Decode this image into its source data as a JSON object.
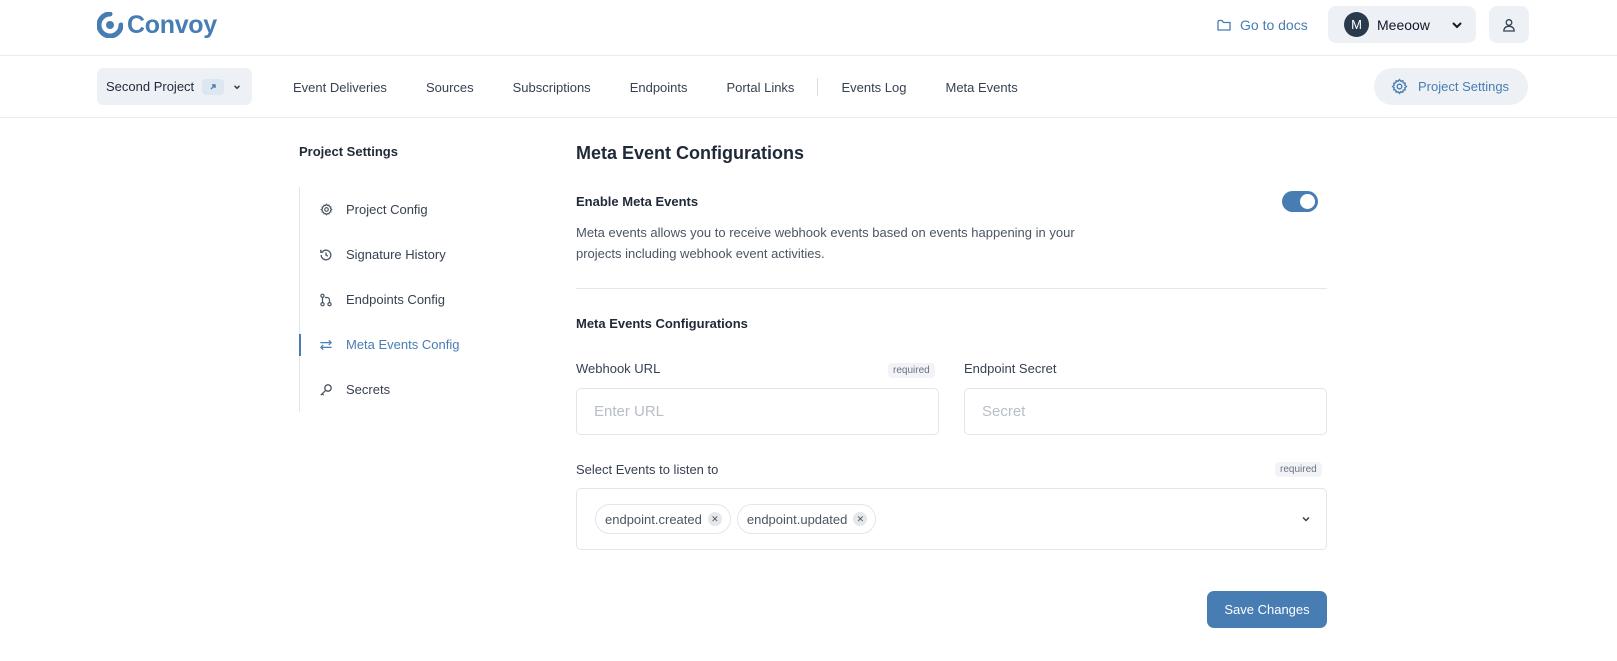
{
  "header": {
    "logo_text": "Convoy",
    "docs_link": "Go to docs",
    "user": {
      "initial": "M",
      "name": "Meeoow"
    }
  },
  "nav": {
    "project": "Second Project",
    "items": [
      "Event Deliveries",
      "Sources",
      "Subscriptions",
      "Endpoints",
      "Portal Links",
      "Events Log",
      "Meta Events"
    ],
    "settings_button": "Project Settings"
  },
  "sidebar": {
    "title": "Project Settings",
    "items": [
      {
        "label": "Project Config",
        "icon": "gear-icon"
      },
      {
        "label": "Signature History",
        "icon": "history-icon"
      },
      {
        "label": "Endpoints Config",
        "icon": "git-branch-icon"
      },
      {
        "label": "Meta Events Config",
        "icon": "arrows-swap-icon",
        "active": true
      },
      {
        "label": "Secrets",
        "icon": "key-icon"
      }
    ]
  },
  "main": {
    "title": "Meta Event Configurations",
    "enable_label": "Enable Meta Events",
    "enabled": true,
    "description": "Meta events allows you to receive webhook events based on events happening in your projects including webhook event activities.",
    "config_title": "Meta Events Configurations",
    "webhook_url": {
      "label": "Webhook URL",
      "badge": "required",
      "placeholder": "Enter URL",
      "value": ""
    },
    "endpoint_secret": {
      "label": "Endpoint Secret",
      "placeholder": "Secret",
      "value": ""
    },
    "events": {
      "label": "Select Events to listen to",
      "badge": "required",
      "selected": [
        "endpoint.created",
        "endpoint.updated"
      ]
    },
    "save_button": "Save Changes"
  },
  "colors": {
    "accent": "#477db3",
    "chip_bg": "#edf1f6",
    "border": "#e2e6ec"
  }
}
